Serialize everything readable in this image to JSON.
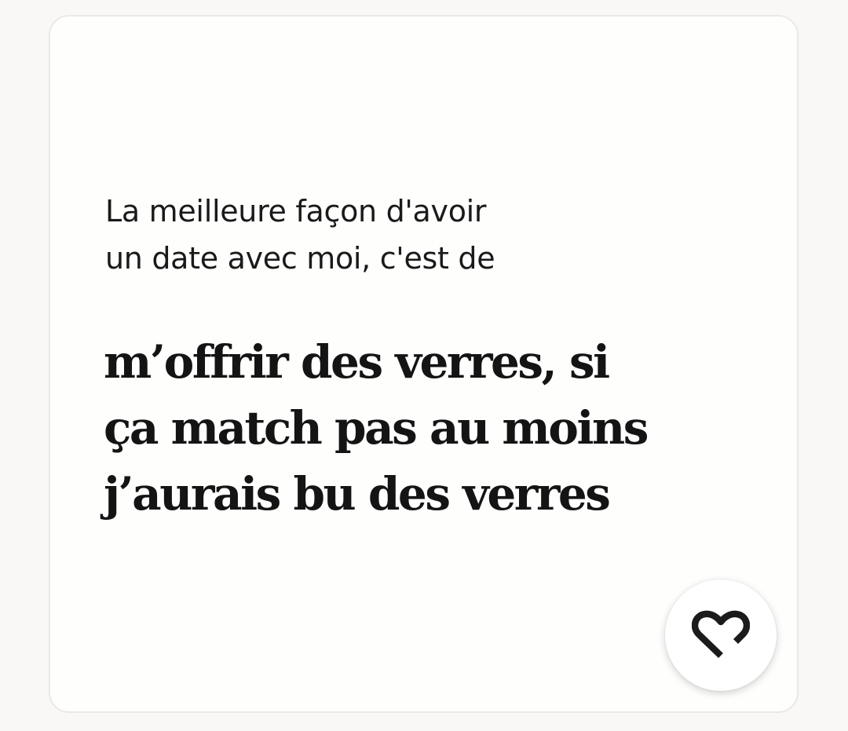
{
  "prompt_card": {
    "prompt_lines": [
      "La meilleure façon d'avoir",
      "un date avec moi, c'est de"
    ],
    "answer_lines": [
      "m’offrir des verres, si",
      "ça match pas au moins",
      "j’aurais bu des verres"
    ],
    "like_icon": "heart-icon"
  }
}
